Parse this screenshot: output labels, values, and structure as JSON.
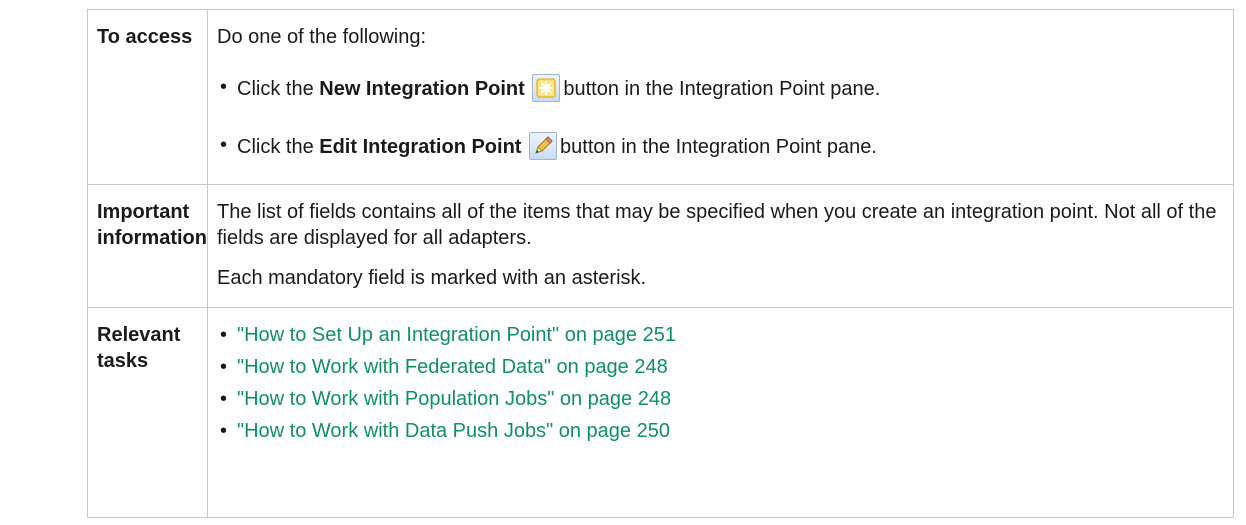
{
  "access": {
    "label": "To access",
    "intro": "Do one of the following:",
    "items": [
      {
        "before": "Click the ",
        "bold": "New Integration Point",
        "icon": "new-star-icon",
        "after": "button in the Integration Point pane."
      },
      {
        "before": "Click the ",
        "bold": "Edit Integration Point",
        "icon": "pencil-edit-icon",
        "after": "button in the Integration Point pane."
      }
    ]
  },
  "info": {
    "label_line1": "Important",
    "label_line2": "information",
    "para1": "The list of fields contains all of the items that may be specified when you create an integration point. Not all of the fields are displayed for all adapters.",
    "para2": "Each mandatory field is marked with an asterisk."
  },
  "tasks": {
    "label_line1": "Relevant",
    "label_line2": "tasks",
    "links": [
      "\"How to Set Up an Integration Point\" on page 251",
      "\"How to Work with Federated Data\" on page 248",
      "\"How to Work with Population Jobs\" on page 248",
      "\"How to Work with Data Push Jobs\" on page 250"
    ]
  },
  "colors": {
    "link": "#0e8f6a",
    "border": "#c8c8c8"
  }
}
